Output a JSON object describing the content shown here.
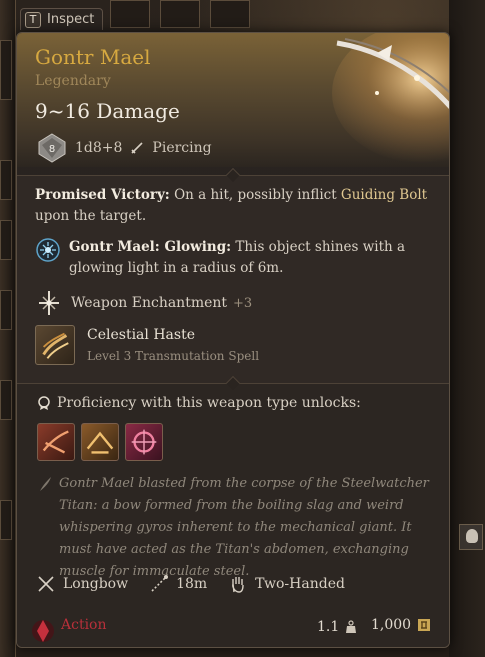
{
  "inspect": {
    "key": "T",
    "label": "Inspect"
  },
  "item": {
    "name": "Gontr Mael",
    "rarity": "Legendary",
    "damage": "9~16 Damage",
    "die_face": "8",
    "dice": "1d8+8",
    "damage_type": "Piercing"
  },
  "description": {
    "lead": "Promised Victory:",
    "text_1": " On a hit, possibly inflict ",
    "link": "Guiding Bolt",
    "text_2": " upon the target."
  },
  "glowing": {
    "lead": "Gontr Mael: Glowing:",
    "text": " This object shines with a glowing light in a radius of 6m."
  },
  "enchantment": {
    "label": "Weapon Enchantment",
    "value": "+3"
  },
  "spell": {
    "name": "Celestial Haste",
    "subtitle": "Level 3 Transmutation Spell"
  },
  "proficiency": {
    "heading": "Proficiency with this weapon type unlocks:"
  },
  "lore": "Gontr Mael blasted from the corpse of the Steelwatcher Titan: a bow formed from the boiling slag and weird whispering gyros inherent to the mechanical giant. It must have acted as the Titan's abdomen, exchanging muscle for immaculate steel.",
  "properties": {
    "type": "Longbow",
    "range": "18m",
    "handedness": "Two-Handed"
  },
  "footer": {
    "action": "Action",
    "weight": "1.1",
    "price": "1,000"
  },
  "colors": {
    "title": "#d7a940",
    "action": "#b8303a",
    "rarity": "#a0875a"
  }
}
